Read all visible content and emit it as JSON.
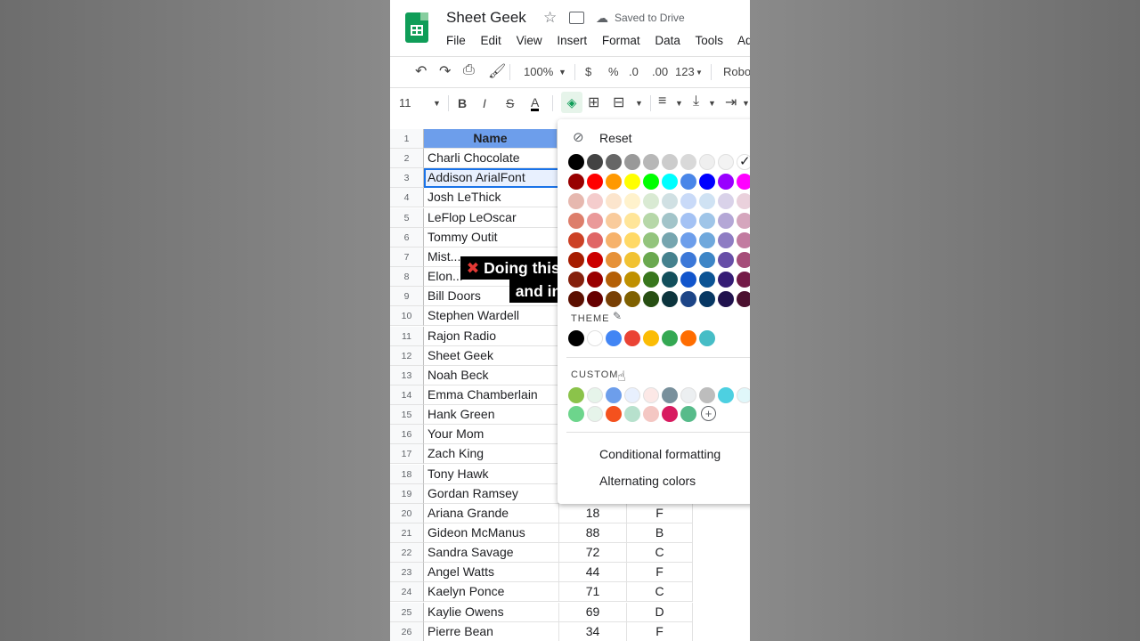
{
  "header": {
    "title": "Sheet Geek",
    "saved": "Saved to Drive",
    "menu": [
      "File",
      "Edit",
      "View",
      "Insert",
      "Format",
      "Data",
      "Tools",
      "Add-o"
    ]
  },
  "toolbar": {
    "zoom": "100%",
    "currency": "$",
    "percent": "%",
    "dec_less": ".0",
    "dec_more": ".00",
    "format": "123",
    "font": "Roboto",
    "font_size": "11",
    "bold": "B",
    "italic": "I",
    "strike": "S",
    "text_color": "A"
  },
  "sheet": {
    "header": "Name",
    "rows": [
      {
        "n": "1"
      },
      {
        "n": "2",
        "name": "Charli Chocolate"
      },
      {
        "n": "3",
        "name": "Addison ArialFont"
      },
      {
        "n": "4",
        "name": "Josh LeThick"
      },
      {
        "n": "5",
        "name": "LeFlop LeOscar"
      },
      {
        "n": "6",
        "name": "Tommy Outit"
      },
      {
        "n": "7",
        "name": "Mist..."
      },
      {
        "n": "8",
        "name": "Elon..."
      },
      {
        "n": "9",
        "name": "Bill Doors"
      },
      {
        "n": "10",
        "name": "Stephen Wardell"
      },
      {
        "n": "11",
        "name": "Rajon Radio"
      },
      {
        "n": "12",
        "name": "Sheet Geek"
      },
      {
        "n": "13",
        "name": "Noah Beck"
      },
      {
        "n": "14",
        "name": "Emma Chamberlain"
      },
      {
        "n": "15",
        "name": "Hank Green"
      },
      {
        "n": "16",
        "name": "Your Mom"
      },
      {
        "n": "17",
        "name": "Zach King"
      },
      {
        "n": "18",
        "name": "Tony Hawk"
      },
      {
        "n": "19",
        "name": "Gordan Ramsey"
      },
      {
        "n": "20",
        "name": "Ariana Grande",
        "score": "18",
        "grade": "F"
      },
      {
        "n": "21",
        "name": "Gideon McManus",
        "score": "88",
        "grade": "B"
      },
      {
        "n": "22",
        "name": "Sandra Savage",
        "score": "72",
        "grade": "C"
      },
      {
        "n": "23",
        "name": "Angel Watts",
        "score": "44",
        "grade": "F"
      },
      {
        "n": "24",
        "name": "Kaelyn Ponce",
        "score": "71",
        "grade": "C"
      },
      {
        "n": "25",
        "name": "Kaylie Owens",
        "score": "69",
        "grade": "D"
      },
      {
        "n": "26",
        "name": "Pierre Bean",
        "score": "34",
        "grade": "F"
      }
    ]
  },
  "palette": {
    "reset": "Reset",
    "theme_label": "THEME",
    "custom_label": "CUSTOM",
    "conditional": "Conditional formatting",
    "alternating": "Alternating colors",
    "main_rows": [
      [
        "#000000",
        "#434343",
        "#666666",
        "#999999",
        "#b7b7b7",
        "#cccccc",
        "#d9d9d9",
        "#efefef",
        "#f3f3f3",
        "#ffffff"
      ],
      [
        "#980000",
        "#ff0000",
        "#ff9900",
        "#ffff00",
        "#00ff00",
        "#00ffff",
        "#4a86e8",
        "#0000ff",
        "#9900ff",
        "#ff00ff"
      ],
      [
        "#e6b8af",
        "#f4cccc",
        "#fce5cd",
        "#fff2cc",
        "#d9ead3",
        "#d0e0e3",
        "#c9daf8",
        "#cfe2f3",
        "#d9d2e9",
        "#ead1dc"
      ],
      [
        "#dd7e6b",
        "#ea9999",
        "#f9cb9c",
        "#ffe599",
        "#b6d7a8",
        "#a2c4c9",
        "#a4c2f4",
        "#9fc5e8",
        "#b4a7d6",
        "#d5a6bd"
      ],
      [
        "#cc4125",
        "#e06666",
        "#f6b26b",
        "#ffd966",
        "#93c47d",
        "#76a5af",
        "#6d9eeb",
        "#6fa8dc",
        "#8e7cc3",
        "#c27ba0"
      ],
      [
        "#a61c00",
        "#cc0000",
        "#e69138",
        "#f1c232",
        "#6aa84f",
        "#45818e",
        "#3c78d8",
        "#3d85c6",
        "#674ea7",
        "#a64d79"
      ],
      [
        "#85200c",
        "#990000",
        "#b45f06",
        "#bf9000",
        "#38761d",
        "#134f5c",
        "#1155cc",
        "#0b5394",
        "#351c75",
        "#741b47"
      ],
      [
        "#5b0f00",
        "#660000",
        "#783f04",
        "#7f6000",
        "#274e13",
        "#0c343d",
        "#1c4587",
        "#073763",
        "#20124d",
        "#4c1130"
      ]
    ],
    "theme": [
      "#000000",
      "#ffffff",
      "#4285f4",
      "#ea4335",
      "#fbbc04",
      "#34a853",
      "#ff6d01",
      "#46bdc6"
    ],
    "custom_row1": [
      "#8bc34a",
      "#e6f4ea",
      "#6d9eeb",
      "#e8f0fe",
      "#fce8e6",
      "#78909c",
      "#eceff1",
      "#bdbdbd",
      "#4dd0e1",
      "#e0f7fa"
    ],
    "custom_row2": [
      "#6dd58c",
      "#e6f4ea",
      "#f4511e",
      "#b7e1cd",
      "#f4c7c3",
      "#d81b60",
      "#57bb8a"
    ]
  },
  "caption": {
    "line1": "Doing this is very slow",
    "line2": "and inefficient",
    "mark": "✖"
  }
}
